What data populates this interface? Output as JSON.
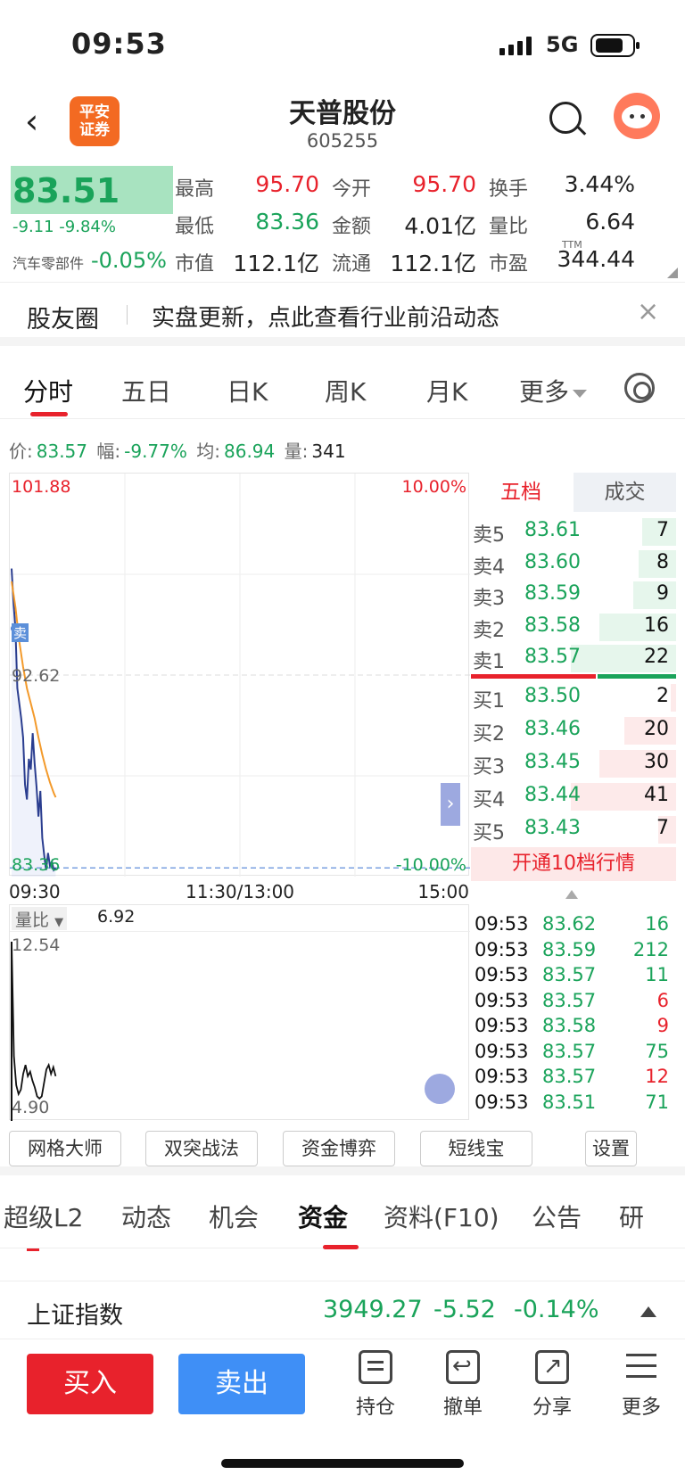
{
  "status": {
    "time": "09:53",
    "network": "5G"
  },
  "header": {
    "logo_text": "平安\n证券",
    "title": "天普股份",
    "code": "605255"
  },
  "quote": {
    "price": "83.51",
    "change": "-9.11  -9.84%",
    "industry": "汽车零部件",
    "industry_change": "-0.05%",
    "rows": [
      [
        {
          "label": "最高",
          "value": "95.70",
          "color": "red"
        },
        {
          "label": "今开",
          "value": "95.70",
          "color": "red"
        },
        {
          "label": "换手",
          "value": "3.44%",
          "color": "black"
        }
      ],
      [
        {
          "label": "最低",
          "value": "83.36",
          "color": "green"
        },
        {
          "label": "金额",
          "value": "4.01亿",
          "color": "black"
        },
        {
          "label": "量比",
          "value": "6.64",
          "color": "black"
        }
      ],
      [
        {
          "label": "市值",
          "value": "112.1亿",
          "color": "black"
        },
        {
          "label": "流通",
          "value": "112.1亿",
          "color": "black"
        },
        {
          "label": "市盈",
          "value": "344.44",
          "color": "black"
        }
      ]
    ],
    "ttm": "TTM"
  },
  "banner": {
    "title": "股友圈",
    "text": "实盘更新，点此查看行业前沿动态",
    "close": "×"
  },
  "chart_tabs": [
    "分时",
    "五日",
    "日K",
    "周K",
    "月K",
    "更多"
  ],
  "info_line": {
    "price_label": "价:",
    "price": "83.57",
    "amp_label": "幅:",
    "amp": "-9.77%",
    "avg_label": "均:",
    "avg": "86.94",
    "vol_label": "量:",
    "vol": "341"
  },
  "chart_data": {
    "type": "line",
    "title": "",
    "y_labels": {
      "top": "101.88",
      "mid": "92.62",
      "bottom": "83.36",
      "top_pct": "10.00%",
      "bottom_pct": "-10.00%"
    },
    "ylim": [
      83.36,
      101.88
    ],
    "x_ticks": [
      "09:30",
      "11:30/13:00",
      "15:00"
    ],
    "sell_marker": "卖",
    "series": [
      {
        "name": "",
        "color": "#2a3d8f",
        "x": [
          0,
          1,
          2,
          3,
          4,
          5,
          6,
          7,
          8,
          9,
          10,
          11,
          12,
          13,
          14,
          15,
          16,
          17,
          18,
          19,
          20,
          21,
          22,
          23
        ],
        "values": [
          97.6,
          96.0,
          94.8,
          92.0,
          91.3,
          90.6,
          89.7,
          87.5,
          86.8,
          88.7,
          88.2,
          89.9,
          88.5,
          87.4,
          86.0,
          87.2,
          85.0,
          84.2,
          83.5,
          84.3,
          83.7,
          83.9,
          83.5,
          83.6
        ]
      },
      {
        "name": "",
        "color": "#f39a2b",
        "x": [
          0,
          2,
          4,
          6,
          8,
          10,
          12,
          14,
          16,
          18,
          20,
          22,
          23
        ],
        "values": [
          97.0,
          95.8,
          94.2,
          93.0,
          92.0,
          91.3,
          90.6,
          89.7,
          88.9,
          88.2,
          87.6,
          87.1,
          86.9
        ]
      }
    ],
    "volume": {
      "label": "量比",
      "value": "6.92",
      "y_labels": {
        "top": "12.54",
        "bottom": "4.90"
      },
      "ylim": [
        4.9,
        12.54
      ],
      "values": [
        12.5,
        7.4,
        6.1,
        5.7,
        5.9,
        6.6,
        7.0,
        6.5,
        6.7,
        6.3,
        6.0,
        5.6,
        5.5,
        5.6,
        6.2,
        6.8,
        7.0,
        6.6,
        6.9,
        6.5
      ]
    }
  },
  "order_book": {
    "tabs": [
      "五档",
      "成交"
    ],
    "asks": [
      {
        "label": "卖5",
        "price": "83.61",
        "qty": "7",
        "level": 0.32
      },
      {
        "label": "卖4",
        "price": "83.60",
        "qty": "8",
        "level": 0.36
      },
      {
        "label": "卖3",
        "price": "83.59",
        "qty": "9",
        "level": 0.41
      },
      {
        "label": "卖2",
        "price": "83.58",
        "qty": "16",
        "level": 0.73
      },
      {
        "label": "卖1",
        "price": "83.57",
        "qty": "22",
        "level": 1.0
      }
    ],
    "bids": [
      {
        "label": "买1",
        "price": "83.50",
        "qty": "2",
        "level": 0.05
      },
      {
        "label": "买2",
        "price": "83.46",
        "qty": "20",
        "level": 0.49
      },
      {
        "label": "买3",
        "price": "83.45",
        "qty": "30",
        "level": 0.73
      },
      {
        "label": "买4",
        "price": "83.44",
        "qty": "41",
        "level": 1.0
      },
      {
        "label": "买5",
        "price": "83.43",
        "qty": "7",
        "level": 0.17
      }
    ],
    "open10": "开通10档行情"
  },
  "trades": [
    {
      "time": "09:53",
      "price": "83.62",
      "vol": "16",
      "dir": "green"
    },
    {
      "time": "09:53",
      "price": "83.59",
      "vol": "212",
      "dir": "green"
    },
    {
      "time": "09:53",
      "price": "83.57",
      "vol": "11",
      "dir": "green"
    },
    {
      "time": "09:53",
      "price": "83.57",
      "vol": "6",
      "dir": "red"
    },
    {
      "time": "09:53",
      "price": "83.58",
      "vol": "9",
      "dir": "red"
    },
    {
      "time": "09:53",
      "price": "83.57",
      "vol": "75",
      "dir": "green"
    },
    {
      "time": "09:53",
      "price": "83.57",
      "vol": "12",
      "dir": "red"
    },
    {
      "time": "09:53",
      "price": "83.51",
      "vol": "71",
      "dir": "green"
    }
  ],
  "tools": [
    "网格大师",
    "双突战法",
    "资金博弈",
    "短线宝",
    "设置"
  ],
  "bottom_tabs": [
    "超级L2",
    "动态",
    "机会",
    "资金",
    "资料(F10)",
    "公告",
    "研"
  ],
  "index_bar": {
    "name": "上证指数",
    "value": "3949.27",
    "change": "-5.52",
    "pct": "-0.14%"
  },
  "actions": {
    "buy": "买入",
    "sell": "卖出",
    "items": [
      "持仓",
      "撤单",
      "分享",
      "更多"
    ]
  }
}
